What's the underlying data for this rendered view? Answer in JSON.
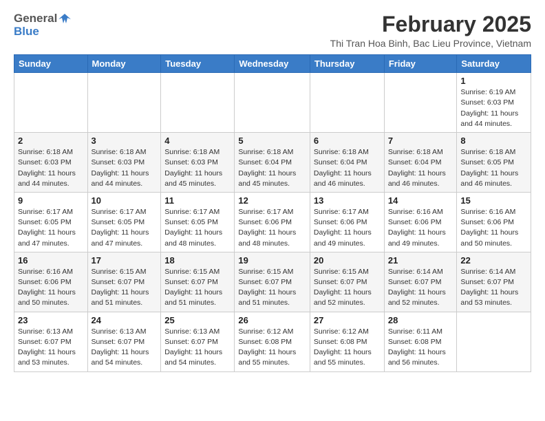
{
  "header": {
    "logo_general": "General",
    "logo_blue": "Blue",
    "main_title": "February 2025",
    "subtitle": "Thi Tran Hoa Binh, Bac Lieu Province, Vietnam"
  },
  "calendar": {
    "weekdays": [
      "Sunday",
      "Monday",
      "Tuesday",
      "Wednesday",
      "Thursday",
      "Friday",
      "Saturday"
    ],
    "weeks": [
      [
        {
          "day": "",
          "info": ""
        },
        {
          "day": "",
          "info": ""
        },
        {
          "day": "",
          "info": ""
        },
        {
          "day": "",
          "info": ""
        },
        {
          "day": "",
          "info": ""
        },
        {
          "day": "",
          "info": ""
        },
        {
          "day": "1",
          "info": "Sunrise: 6:19 AM\nSunset: 6:03 PM\nDaylight: 11 hours\nand 44 minutes."
        }
      ],
      [
        {
          "day": "2",
          "info": "Sunrise: 6:18 AM\nSunset: 6:03 PM\nDaylight: 11 hours\nand 44 minutes."
        },
        {
          "day": "3",
          "info": "Sunrise: 6:18 AM\nSunset: 6:03 PM\nDaylight: 11 hours\nand 44 minutes."
        },
        {
          "day": "4",
          "info": "Sunrise: 6:18 AM\nSunset: 6:03 PM\nDaylight: 11 hours\nand 45 minutes."
        },
        {
          "day": "5",
          "info": "Sunrise: 6:18 AM\nSunset: 6:04 PM\nDaylight: 11 hours\nand 45 minutes."
        },
        {
          "day": "6",
          "info": "Sunrise: 6:18 AM\nSunset: 6:04 PM\nDaylight: 11 hours\nand 46 minutes."
        },
        {
          "day": "7",
          "info": "Sunrise: 6:18 AM\nSunset: 6:04 PM\nDaylight: 11 hours\nand 46 minutes."
        },
        {
          "day": "8",
          "info": "Sunrise: 6:18 AM\nSunset: 6:05 PM\nDaylight: 11 hours\nand 46 minutes."
        }
      ],
      [
        {
          "day": "9",
          "info": "Sunrise: 6:17 AM\nSunset: 6:05 PM\nDaylight: 11 hours\nand 47 minutes."
        },
        {
          "day": "10",
          "info": "Sunrise: 6:17 AM\nSunset: 6:05 PM\nDaylight: 11 hours\nand 47 minutes."
        },
        {
          "day": "11",
          "info": "Sunrise: 6:17 AM\nSunset: 6:05 PM\nDaylight: 11 hours\nand 48 minutes."
        },
        {
          "day": "12",
          "info": "Sunrise: 6:17 AM\nSunset: 6:06 PM\nDaylight: 11 hours\nand 48 minutes."
        },
        {
          "day": "13",
          "info": "Sunrise: 6:17 AM\nSunset: 6:06 PM\nDaylight: 11 hours\nand 49 minutes."
        },
        {
          "day": "14",
          "info": "Sunrise: 6:16 AM\nSunset: 6:06 PM\nDaylight: 11 hours\nand 49 minutes."
        },
        {
          "day": "15",
          "info": "Sunrise: 6:16 AM\nSunset: 6:06 PM\nDaylight: 11 hours\nand 50 minutes."
        }
      ],
      [
        {
          "day": "16",
          "info": "Sunrise: 6:16 AM\nSunset: 6:06 PM\nDaylight: 11 hours\nand 50 minutes."
        },
        {
          "day": "17",
          "info": "Sunrise: 6:15 AM\nSunset: 6:07 PM\nDaylight: 11 hours\nand 51 minutes."
        },
        {
          "day": "18",
          "info": "Sunrise: 6:15 AM\nSunset: 6:07 PM\nDaylight: 11 hours\nand 51 minutes."
        },
        {
          "day": "19",
          "info": "Sunrise: 6:15 AM\nSunset: 6:07 PM\nDaylight: 11 hours\nand 51 minutes."
        },
        {
          "day": "20",
          "info": "Sunrise: 6:15 AM\nSunset: 6:07 PM\nDaylight: 11 hours\nand 52 minutes."
        },
        {
          "day": "21",
          "info": "Sunrise: 6:14 AM\nSunset: 6:07 PM\nDaylight: 11 hours\nand 52 minutes."
        },
        {
          "day": "22",
          "info": "Sunrise: 6:14 AM\nSunset: 6:07 PM\nDaylight: 11 hours\nand 53 minutes."
        }
      ],
      [
        {
          "day": "23",
          "info": "Sunrise: 6:13 AM\nSunset: 6:07 PM\nDaylight: 11 hours\nand 53 minutes."
        },
        {
          "day": "24",
          "info": "Sunrise: 6:13 AM\nSunset: 6:07 PM\nDaylight: 11 hours\nand 54 minutes."
        },
        {
          "day": "25",
          "info": "Sunrise: 6:13 AM\nSunset: 6:07 PM\nDaylight: 11 hours\nand 54 minutes."
        },
        {
          "day": "26",
          "info": "Sunrise: 6:12 AM\nSunset: 6:08 PM\nDaylight: 11 hours\nand 55 minutes."
        },
        {
          "day": "27",
          "info": "Sunrise: 6:12 AM\nSunset: 6:08 PM\nDaylight: 11 hours\nand 55 minutes."
        },
        {
          "day": "28",
          "info": "Sunrise: 6:11 AM\nSunset: 6:08 PM\nDaylight: 11 hours\nand 56 minutes."
        },
        {
          "day": "",
          "info": ""
        }
      ]
    ]
  }
}
